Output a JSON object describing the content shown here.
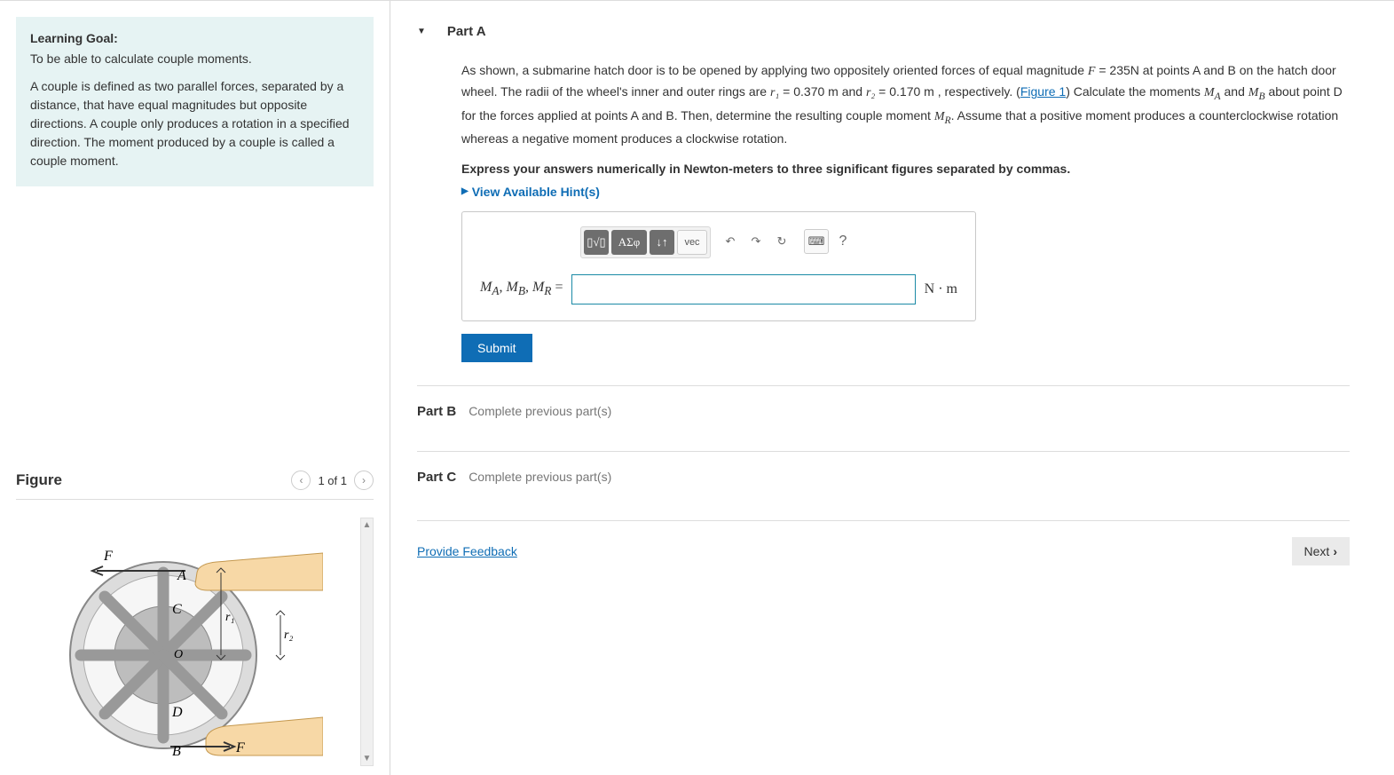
{
  "left": {
    "learning_goal_title": "Learning Goal:",
    "learning_goal_sub": "To be able to calculate couple moments.",
    "learning_goal_body": "A couple is defined as two parallel forces, separated by a distance, that have equal magnitudes but opposite directions. A couple only produces a rotation in a specified direction. The moment produced by a couple is called a couple moment.",
    "figure_title": "Figure",
    "figure_count": "1 of 1",
    "wheel_labels": {
      "A": "A",
      "B": "B",
      "C": "C",
      "D": "D",
      "O": "O",
      "F_left": "F",
      "F_right": "F",
      "r1": "r₁",
      "r2": "r₂"
    }
  },
  "right": {
    "partA": {
      "title": "Part A",
      "body_prefix": "As shown, a submarine hatch door is to be opened by applying two oppositely oriented forces of equal magnitude ",
      "F_label": "F",
      "F_eq": " = 235N",
      "body_mid1": " at points A and B on the hatch door wheel. The radii of the wheel's inner and outer rings are ",
      "r1_label": "r₁",
      "r1_val": " = 0.370 m",
      "and": " and ",
      "r2_label": "r₂",
      "r2_val": " = 0.170 m ",
      "body_mid2": ", respectively. (",
      "fig_link": "Figure 1",
      "body_mid3": ") Calculate the moments ",
      "MA": "M_A",
      "body_mid4": " and ",
      "MB": "M_B",
      "body_mid5": " about point D for the forces applied at points A and B. Then, determine the resulting couple moment ",
      "MR": "M_R",
      "body_end": ". Assume that a positive moment produces a counterclockwise rotation whereas a negative moment produces a clockwise rotation.",
      "instruction": "Express your answers numerically in Newton-meters to three significant figures separated by commas.",
      "hints": "View Available Hint(s)",
      "answer_label_html": "M_A, M_B, M_R =",
      "units": "N · m",
      "submit": "Submit"
    },
    "partB": {
      "label": "Part B",
      "note": "Complete previous part(s)"
    },
    "partC": {
      "label": "Part C",
      "note": "Complete previous part(s)"
    },
    "feedback": "Provide Feedback",
    "next": "Next"
  },
  "toolbar": {
    "templates_icon": "▯√▯",
    "greek_icon": "ΑΣφ",
    "subsup_icon": "↓↑",
    "vec_icon": "vec",
    "undo_icon": "↶",
    "redo_icon": "↷",
    "reset_icon": "↻",
    "keyboard_icon": "⌨",
    "help_icon": "?"
  }
}
